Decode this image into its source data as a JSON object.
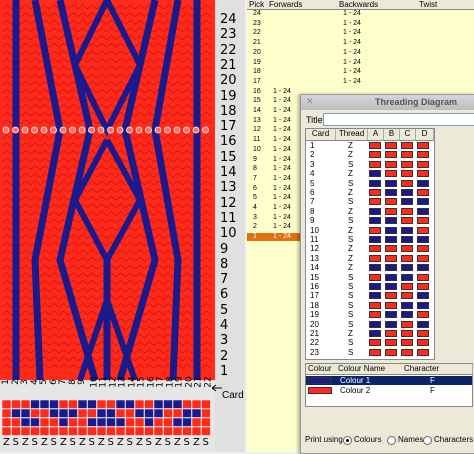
{
  "weave": {
    "row_numbers": [
      "24",
      "23",
      "22",
      "21",
      "20",
      "19",
      "18",
      "17",
      "16",
      "15",
      "14",
      "13",
      "12",
      "11",
      "10",
      "9",
      "8",
      "7",
      "6",
      "5",
      "4",
      "3",
      "2",
      "1"
    ],
    "col_numbers": [
      "1",
      "2",
      "3",
      "4",
      "5",
      "6",
      "7",
      "8",
      "9",
      "10",
      "11",
      "12",
      "13",
      "14",
      "15",
      "16",
      "17",
      "18",
      "19",
      "20",
      "21",
      "22"
    ],
    "card_label": "Card",
    "thread_dirs": [
      "Z",
      "S",
      "Z",
      "S",
      "Z",
      "S",
      "Z",
      "S",
      "Z",
      "S",
      "Z",
      "S",
      "Z",
      "S",
      "Z",
      "S",
      "Z",
      "S",
      "Z",
      "S",
      "Z",
      "S"
    ],
    "colors": {
      "red": "#ff2a1a",
      "blue": "#1a1a8c",
      "grey": "#e0e0e0"
    }
  },
  "pick_table": {
    "headers": [
      "Pick",
      "Forwards",
      "Backwards",
      "Twist"
    ],
    "rows": [
      {
        "pick": "24",
        "forwards": "",
        "backwards": "1 - 24"
      },
      {
        "pick": "23",
        "forwards": "",
        "backwards": "1 - 24"
      },
      {
        "pick": "22",
        "forwards": "",
        "backwards": "1 - 24"
      },
      {
        "pick": "21",
        "forwards": "",
        "backwards": "1 - 24"
      },
      {
        "pick": "20",
        "forwards": "",
        "backwards": "1 - 24"
      },
      {
        "pick": "19",
        "forwards": "",
        "backwards": "1 - 24"
      },
      {
        "pick": "18",
        "forwards": "",
        "backwards": "1 - 24"
      },
      {
        "pick": "17",
        "forwards": "",
        "backwards": "1 - 24"
      },
      {
        "pick": "16",
        "forwards": "1 - 24",
        "backwards": ""
      },
      {
        "pick": "15",
        "forwards": "1 - 24",
        "backwards": ""
      },
      {
        "pick": "14",
        "forwards": "1 - 24",
        "backwards": ""
      },
      {
        "pick": "13",
        "forwards": "1 - 24",
        "backwards": ""
      },
      {
        "pick": "12",
        "forwards": "1 - 24",
        "backwards": ""
      },
      {
        "pick": "11",
        "forwards": "1 - 24",
        "backwards": ""
      },
      {
        "pick": "10",
        "forwards": "1 - 24",
        "backwards": ""
      },
      {
        "pick": "9",
        "forwards": "1 - 24",
        "backwards": ""
      },
      {
        "pick": "8",
        "forwards": "1 - 24",
        "backwards": ""
      },
      {
        "pick": "7",
        "forwards": "1 - 24",
        "backwards": ""
      },
      {
        "pick": "6",
        "forwards": "1 - 24",
        "backwards": ""
      },
      {
        "pick": "5",
        "forwards": "1 - 24",
        "backwards": ""
      },
      {
        "pick": "4",
        "forwards": "1 - 24",
        "backwards": ""
      },
      {
        "pick": "3",
        "forwards": "1 - 24",
        "backwards": ""
      },
      {
        "pick": "2",
        "forwards": "1 - 24",
        "backwards": ""
      },
      {
        "pick": "1",
        "forwards": "1 - 24",
        "backwards": ""
      }
    ],
    "selected_pick": "1"
  },
  "dialog": {
    "title": "Threading Diagram",
    "title_label": "Title",
    "title_value": "",
    "card_headers": [
      "Card",
      "Thread",
      "A",
      "B",
      "C",
      "D"
    ],
    "cards": [
      {
        "card": "1",
        "thread": "Z",
        "holes": [
          "r",
          "r",
          "r",
          "r"
        ]
      },
      {
        "card": "2",
        "thread": "Z",
        "holes": [
          "r",
          "r",
          "r",
          "r"
        ]
      },
      {
        "card": "3",
        "thread": "S",
        "holes": [
          "r",
          "r",
          "r",
          "r"
        ]
      },
      {
        "card": "4",
        "thread": "Z",
        "holes": [
          "b",
          "r",
          "r",
          "r"
        ]
      },
      {
        "card": "5",
        "thread": "S",
        "holes": [
          "b",
          "b",
          "r",
          "b"
        ]
      },
      {
        "card": "6",
        "thread": "Z",
        "holes": [
          "r",
          "b",
          "b",
          "r"
        ]
      },
      {
        "card": "7",
        "thread": "S",
        "holes": [
          "r",
          "r",
          "b",
          "b"
        ]
      },
      {
        "card": "8",
        "thread": "Z",
        "holes": [
          "b",
          "r",
          "r",
          "b"
        ]
      },
      {
        "card": "9",
        "thread": "S",
        "holes": [
          "b",
          "b",
          "r",
          "r"
        ]
      },
      {
        "card": "10",
        "thread": "Z",
        "holes": [
          "r",
          "b",
          "b",
          "r"
        ]
      },
      {
        "card": "11",
        "thread": "S",
        "holes": [
          "b",
          "b",
          "b",
          "b"
        ]
      },
      {
        "card": "12",
        "thread": "Z",
        "holes": [
          "r",
          "r",
          "r",
          "r"
        ]
      },
      {
        "card": "13",
        "thread": "Z",
        "holes": [
          "r",
          "r",
          "r",
          "r"
        ]
      },
      {
        "card": "14",
        "thread": "Z",
        "holes": [
          "b",
          "b",
          "b",
          "b"
        ]
      },
      {
        "card": "15",
        "thread": "S",
        "holes": [
          "r",
          "b",
          "b",
          "r"
        ]
      },
      {
        "card": "16",
        "thread": "S",
        "holes": [
          "b",
          "b",
          "r",
          "r"
        ]
      },
      {
        "card": "17",
        "thread": "S",
        "holes": [
          "b",
          "r",
          "r",
          "b"
        ]
      },
      {
        "card": "18",
        "thread": "S",
        "holes": [
          "r",
          "r",
          "b",
          "b"
        ]
      },
      {
        "card": "19",
        "thread": "S",
        "holes": [
          "r",
          "b",
          "b",
          "r"
        ]
      },
      {
        "card": "20",
        "thread": "S",
        "holes": [
          "b",
          "b",
          "r",
          "b"
        ]
      },
      {
        "card": "21",
        "thread": "Z",
        "holes": [
          "b",
          "r",
          "r",
          "r"
        ]
      },
      {
        "card": "22",
        "thread": "S",
        "holes": [
          "r",
          "r",
          "r",
          "r"
        ]
      },
      {
        "card": "23",
        "thread": "S",
        "holes": [
          "r",
          "r",
          "r",
          "r"
        ]
      }
    ],
    "colour_headers": [
      "Colour",
      "Colour Name",
      "Character"
    ],
    "colours": [
      {
        "name": "Colour 1",
        "character": "F",
        "color": "#1a1a8c"
      },
      {
        "name": "Colour 2",
        "character": "F",
        "color": "#ff2a1a"
      }
    ],
    "print_label": "Print using",
    "print_options": [
      "Colours",
      "Names",
      "Characters"
    ],
    "print_selected": "Colours"
  }
}
